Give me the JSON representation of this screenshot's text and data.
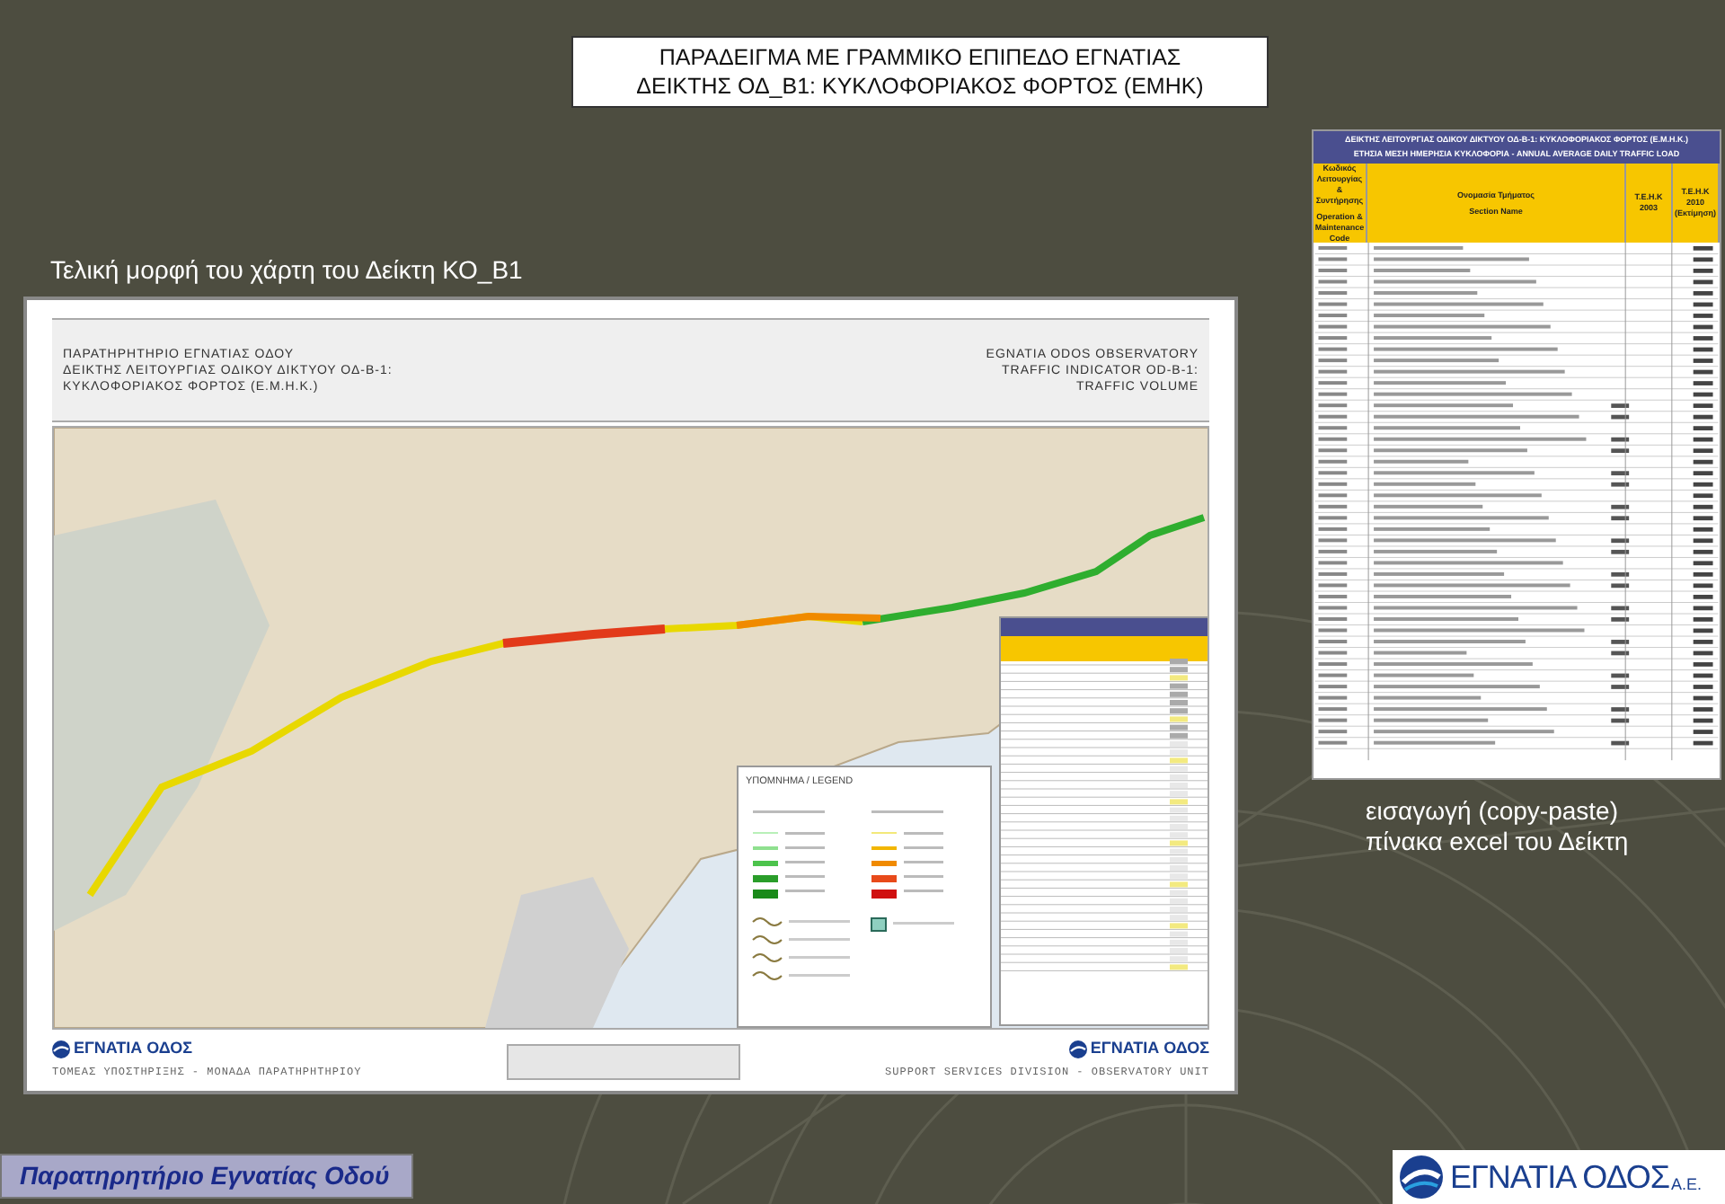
{
  "slide_title": [
    "ΠΑΡΑΔΕΙΓΜΑ ΜΕ ΓΡΑΜΜΙΚΟ ΕΠΙΠΕΔΟ ΕΓΝΑΤΙΑΣ",
    "ΔΕΙΚΤΗΣ ΟΔ_Β1: ΚΥΚΛΟΦΟΡΙΑΚΟΣ ΦΟΡΤΟΣ (ΕΜΗΚ)"
  ],
  "caption": "Τελική μορφή του χάρτη του Δείκτη ΚΟ_Β1",
  "side_note": [
    "εισαγωγή (copy-paste)",
    "πίνακα excel του Δείκτη"
  ],
  "excel_table": {
    "title": "ΔΕΙΚΤΗΣ ΛΕΙΤΟΥΡΓΙΑΣ ΟΔΙΚΟΥ ΔΙΚΤΥΟΥ ΟΔ-Β-1: ΚΥΚΛΟΦΟΡΙΑΚΟΣ ΦΟΡΤΟΣ (Ε.Μ.Η.Κ.)",
    "subtitle": "ΕΤΗΣΙΑ ΜΕΣΗ ΗΜΕΡΗΣΙΑ ΚΥΚΛΟΦΟΡΙΑ - ANNUAL AVERAGE DAILY TRAFFIC LOAD",
    "columns": [
      {
        "label_gr": "Κωδικός Λειτουργίας & Συντήρησης",
        "label_en": "Operation & Maintenance Code"
      },
      {
        "label_gr": "Ονομασία Τμήματος",
        "label_en": "Section Name"
      },
      {
        "label_gr": "Τ.Ε.Η.Κ 2003"
      },
      {
        "label_gr": "Τ.Ε.Η.Κ 2010 (Εκτίμηση)"
      }
    ]
  },
  "map": {
    "header_left": [
      "ΠΑΡΑΤΗΡΗΤΗΡΙΟ ΕΓΝΑΤΙΑΣ ΟΔΟΥ",
      "ΔΕΙΚΤΗΣ ΛΕΙΤΟΥΡΓΙΑΣ ΟΔΙΚΟΥ ΔΙΚΤΥΟΥ ΟΔ-Β-1:",
      "ΚΥΚΛΟΦΟΡΙΑΚΟΣ ΦΟΡΤΟΣ (Ε.Μ.Η.Κ.)"
    ],
    "header_right": [
      "EGNATIA ODOS OBSERVATORY",
      "TRAFFIC INDICATOR OD-B-1:",
      "TRAFFIC VOLUME"
    ],
    "legend_title": "ΥΠΟΜΝΗΜΑ / LEGEND",
    "logo_left": "ΕΓΝΑΤΙΑ ΟΔΟΣ",
    "logo_right": "ΕΓΝΑΤΙΑ ΟΔΟΣ",
    "footer_left": "ΤΟΜΕΑΣ ΥΠΟΣΤΗΡΙΞΗΣ - ΜΟΝΑΔΑ ΠΑΡΑΤΗΡΗΤΗΡΙΟΥ",
    "footer_right": "SUPPORT SERVICES DIVISION - OBSERVATORY UNIT"
  },
  "footer_label": "Παρατηρητήριο Εγνατίας Οδού",
  "logo": {
    "name": "ΕΓΝΑΤΙΑ ΟΔΟΣ",
    "suffix": "Α.Ε."
  }
}
